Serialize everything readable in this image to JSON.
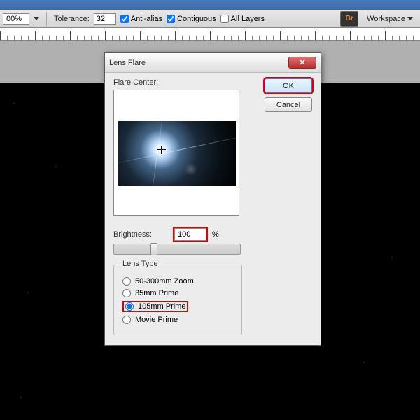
{
  "toolbar": {
    "zoom": "00%",
    "tolerance_label": "Tolerance:",
    "tolerance_value": "32",
    "antialias_label": "Anti-alias",
    "antialias_checked": true,
    "contiguous_label": "Contiguous",
    "contiguous_checked": true,
    "alllayers_label": "All Layers",
    "alllayers_checked": false,
    "bridge_icon": "Br",
    "workspace_label": "Workspace"
  },
  "dialog": {
    "title": "Lens Flare",
    "ok_label": "OK",
    "cancel_label": "Cancel",
    "flare_center_label": "Flare Center:",
    "brightness_label": "Brightness:",
    "brightness_value": "100",
    "brightness_unit": "%",
    "lens_type_label": "Lens Type",
    "options": [
      {
        "label": "50-300mm Zoom",
        "checked": false
      },
      {
        "label": "35mm Prime",
        "checked": false
      },
      {
        "label": "105mm Prime",
        "checked": true
      },
      {
        "label": "Movie Prime",
        "checked": false
      }
    ]
  }
}
